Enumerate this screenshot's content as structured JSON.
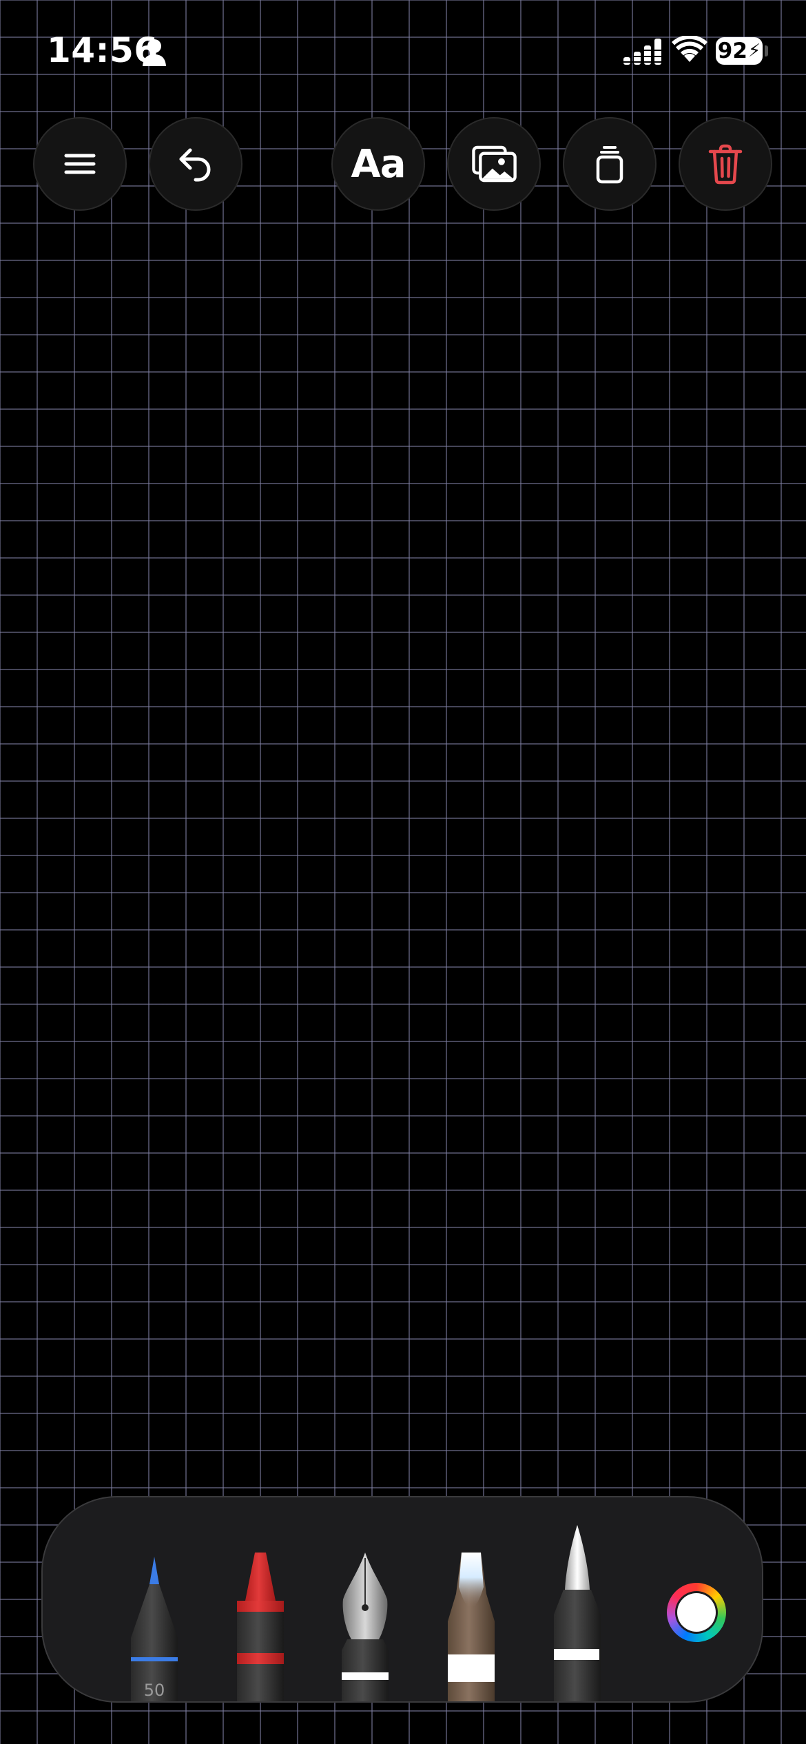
{
  "status_bar": {
    "time": "14:56",
    "battery_level": "92",
    "icons": [
      "person-icon",
      "signal-icon",
      "wifi-icon",
      "battery-charging-icon"
    ]
  },
  "toolbar": {
    "buttons": [
      {
        "name": "menu-button",
        "icon": "hamburger-menu-icon"
      },
      {
        "name": "undo-button",
        "icon": "undo-arrow-icon"
      },
      {
        "name": "text-tool-button",
        "label": "Aa"
      },
      {
        "name": "insert-image-button",
        "icon": "photos-icon"
      },
      {
        "name": "copy-button",
        "icon": "stacked-pages-icon"
      },
      {
        "name": "delete-button",
        "icon": "trash-icon"
      }
    ],
    "delete_color": "#e5484d"
  },
  "pen_tray": {
    "tools": [
      {
        "name": "pen",
        "color": "#3b7ce6",
        "label": "50"
      },
      {
        "name": "marker",
        "color": "#d92b2b"
      },
      {
        "name": "fountain-pen",
        "color": "#ffffff"
      },
      {
        "name": "watercolor-brush",
        "color": "#ffffff"
      },
      {
        "name": "crayon-brush",
        "color": "#ffffff"
      }
    ],
    "selected_color": "#ffffff"
  }
}
